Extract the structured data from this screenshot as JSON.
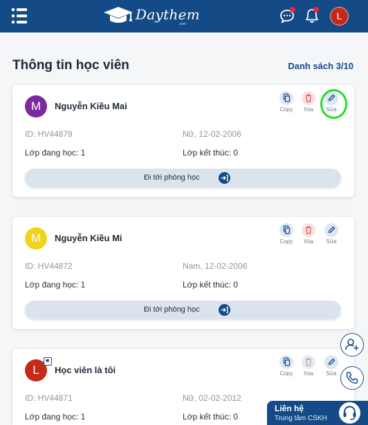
{
  "header": {
    "logo_text": "Daythem",
    "logo_sub": ".com",
    "user_initial": "L",
    "colors": {
      "bar": "#144a86",
      "notification_dot": "#f0263b"
    }
  },
  "page": {
    "title": "Thông tin học viên",
    "list_link": "Danh sách 3/10"
  },
  "labels": {
    "copy": "Copy",
    "delete": "Xóa",
    "edit": "Sửa",
    "goto_room": "Đi tới phòng học"
  },
  "students": [
    {
      "initial": "M",
      "avatar_color": "#7b2a9e",
      "name": "Nguyễn Kiều Mai",
      "id": "ID: HV44879",
      "gender_dob": "Nữ, 12-02-2006",
      "classes_current": "Lớp đang học: 1",
      "classes_done": "Lớp kết thúc: 0"
    },
    {
      "initial": "M",
      "avatar_color": "#f2d21a",
      "name": "Nguyễn Kiều Mi",
      "id": "ID: HV44872",
      "gender_dob": "Nam, 12-02-2006",
      "classes_current": "Lớp đang học: 1",
      "classes_done": "Lớp kết thúc: 0"
    },
    {
      "initial": "L",
      "avatar_color": "#c42a1a",
      "name": "Học viên là tôi",
      "id": "ID: HV44871",
      "gender_dob": "Nữ, 02-02-2012",
      "classes_current": "Lớp đang học: 1",
      "classes_done": "Lớp kết thúc: 0"
    }
  ],
  "contact": {
    "title": "Liên hệ",
    "subtitle": "Trung tâm CSKH"
  },
  "icons": {
    "menu": "menu-icon",
    "chat": "chat-icon",
    "bell": "bell-icon",
    "copy": "copy-icon",
    "delete": "trash-icon",
    "edit": "pencil-icon",
    "enter": "enter-icon",
    "add_user": "add-user-icon",
    "phone": "phone-icon",
    "headset": "headset-icon"
  }
}
